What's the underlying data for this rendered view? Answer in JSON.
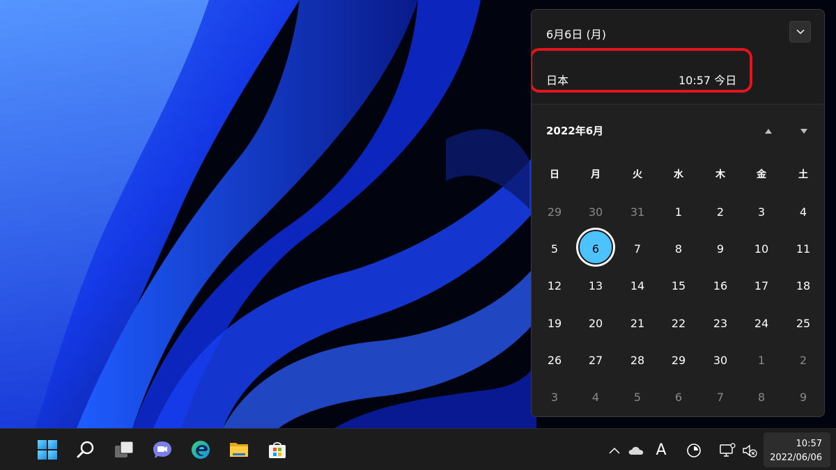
{
  "flyout": {
    "header_date": "6月6日 (月)",
    "clock": {
      "location": "日本",
      "time_day": "10:57 今日"
    },
    "month_label": "2022年6月",
    "weekdays": [
      "日",
      "月",
      "火",
      "水",
      "木",
      "金",
      "土"
    ],
    "weeks": [
      [
        "29",
        "30",
        "31",
        "1",
        "2",
        "3",
        "4"
      ],
      [
        "5",
        "6",
        "7",
        "8",
        "9",
        "10",
        "11"
      ],
      [
        "12",
        "13",
        "14",
        "15",
        "16",
        "17",
        "18"
      ],
      [
        "19",
        "20",
        "21",
        "22",
        "23",
        "24",
        "25"
      ],
      [
        "26",
        "27",
        "28",
        "29",
        "30",
        "1",
        "2"
      ],
      [
        "3",
        "4",
        "5",
        "6",
        "7",
        "8",
        "9"
      ]
    ],
    "selected_day": "6",
    "icons": {
      "collapse": "chevron-down-icon",
      "prev_month": "triangle-up-icon",
      "next_month": "triangle-down-icon"
    },
    "colors": {
      "accent": "#4cc2ff",
      "highlight_ring": "#e3141e"
    }
  },
  "taskbar": {
    "apps": [
      "windows-start-icon",
      "search-icon",
      "task-view-icon",
      "chat-icon",
      "edge-icon",
      "file-explorer-icon",
      "microsoft-store-icon"
    ],
    "tray": {
      "ime_label": "A",
      "icons": [
        "chevron-up-icon",
        "onedrive-cloud-icon",
        "ime-icon",
        "circle-icon",
        "network-icon",
        "speaker-muted-icon"
      ]
    },
    "clock": {
      "time": "10:57",
      "date": "2022/06/06"
    }
  }
}
